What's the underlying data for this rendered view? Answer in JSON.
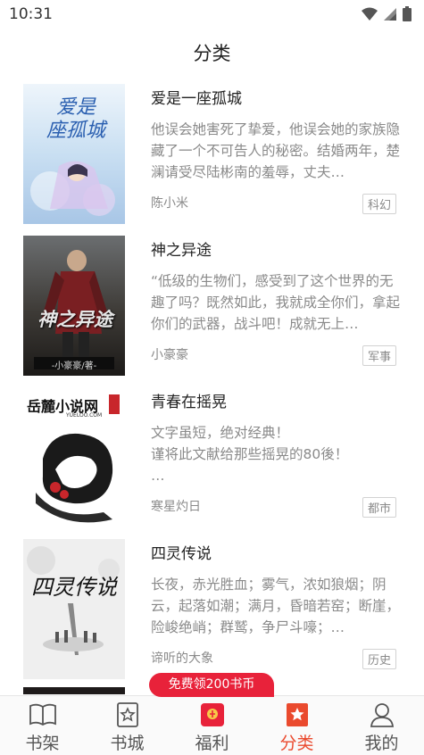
{
  "status": {
    "time": "10:31"
  },
  "header": {
    "title": "分类"
  },
  "books": [
    {
      "title": "爱是一座孤城",
      "description": "他误会她害死了挚爱，他误会她的家族隐藏了一个不可告人的秘密。结婚两年，楚澜请受尽陆彬南的羞辱，丈夫…",
      "author": "陈小米",
      "tag": "科幻",
      "cover_text": "爱是\n座孤城"
    },
    {
      "title": "神之异途",
      "description": "“低级的生物们，感受到了这个世界的无趣了吗？既然如此，我就成全你们，拿起你们的武器，战斗吧！成就无上…",
      "author": "小豪豪",
      "tag": "军事",
      "cover_text": "神之异途",
      "cover_subtext": "-小豪豪/著-"
    },
    {
      "title": "青春在摇晃",
      "description": "文字虽短，绝对经典！\n谨将此文献给那些摇晃的80後！\n…",
      "author": "寒星灼日",
      "tag": "都市",
      "cover_text": "岳麓小说网",
      "cover_subtext": "YUELOO.COM"
    },
    {
      "title": "四灵传说",
      "description": "长夜，赤光胜血；雾气，浓如狼烟；阴云，起落如潮；满月，昏暗若窑；断崖，险峻绝峭；群鹫，争尸斗嚎；…",
      "author": "谛听的大象",
      "tag": "历史",
      "cover_text": "四灵传说"
    }
  ],
  "promo": {
    "label": "免费领200书币"
  },
  "tabs": [
    {
      "label": "书架",
      "icon": "book-open-icon",
      "active": false
    },
    {
      "label": "书城",
      "icon": "bookmark-star-icon",
      "active": false
    },
    {
      "label": "福利",
      "icon": "gift-icon",
      "active": false
    },
    {
      "label": "分类",
      "icon": "category-star-icon",
      "active": true
    },
    {
      "label": "我的",
      "icon": "user-icon",
      "active": false
    }
  ],
  "colors": {
    "accent": "#ea4a2e",
    "promo": "#e8223a",
    "muted_text": "#8a8a8a"
  }
}
